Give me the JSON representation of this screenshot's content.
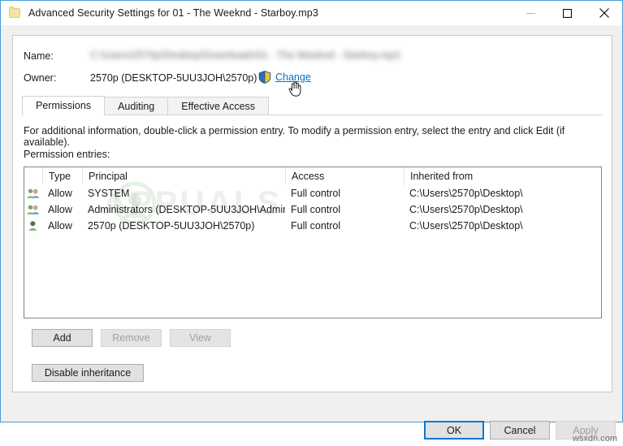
{
  "window": {
    "title": "Advanced Security Settings for 01 - The Weeknd - Starboy.mp3",
    "icon": "folder-icon",
    "minimize_label": "–",
    "maximize_label": "☐",
    "close_label": "✕"
  },
  "header": {
    "name_label": "Name:",
    "name_value": "C:\\Users\\2570p\\Desktop\\Downloads\\01 - The Weeknd - Starboy.mp3",
    "name_value_blurred": true,
    "owner_label": "Owner:",
    "owner_value": "2570p (DESKTOP-5UU3JOH\\2570p)",
    "change_link": "Change",
    "change_icon": "uac-shield-icon"
  },
  "tabs": [
    {
      "label": "Permissions",
      "active": true
    },
    {
      "label": "Auditing",
      "active": false
    },
    {
      "label": "Effective Access",
      "active": false
    }
  ],
  "main": {
    "instruction": "For additional information, double-click a permission entry. To modify a permission entry, select the entry and click Edit (if available).",
    "entries_label": "Permission entries:"
  },
  "table": {
    "columns": [
      "",
      "Type",
      "Principal",
      "Access",
      "Inherited from"
    ],
    "rows": [
      {
        "icon": "group-icon",
        "type": "Allow",
        "principal": "SYSTEM",
        "access": "Full control",
        "inherited_from": "C:\\Users\\2570p\\Desktop\\"
      },
      {
        "icon": "group-icon",
        "type": "Allow",
        "principal": "Administrators (DESKTOP-5UU3JOH\\Admin...",
        "access": "Full control",
        "inherited_from": "C:\\Users\\2570p\\Desktop\\"
      },
      {
        "icon": "user-icon",
        "type": "Allow",
        "principal": "2570p (DESKTOP-5UU3JOH\\2570p)",
        "access": "Full control",
        "inherited_from": "C:\\Users\\2570p\\Desktop\\"
      }
    ]
  },
  "buttons": {
    "add": {
      "label": "Add",
      "enabled": true
    },
    "remove": {
      "label": "Remove",
      "enabled": false
    },
    "view": {
      "label": "View",
      "enabled": false
    },
    "disable_inheritance": {
      "label": "Disable inheritance",
      "enabled": true
    },
    "ok": {
      "label": "OK",
      "enabled": true,
      "focused": true
    },
    "cancel": {
      "label": "Cancel",
      "enabled": true
    },
    "apply": {
      "label": "Apply",
      "enabled": false
    }
  },
  "watermarks": {
    "list_overlay": "APPUALS",
    "corner": "wsxdn.com"
  },
  "colors": {
    "window_border": "#4a9ad4",
    "link": "#0b6ec4",
    "focus": "#0078d7",
    "dialog_bg": "#f0f0f0",
    "panel_bg": "#ffffff"
  }
}
